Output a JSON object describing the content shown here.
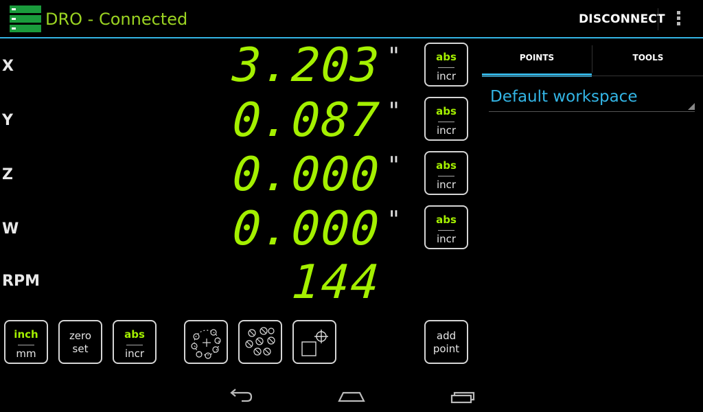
{
  "app": {
    "title": "DRO - Connected",
    "icon": "dro-app-icon",
    "accent": "#33b5e5",
    "digit_color": "#a4f000"
  },
  "actionbar": {
    "disconnect_label": "DISCONNECT",
    "overflow_icon": "overflow-menu-icon"
  },
  "axes": [
    {
      "label": "X",
      "value": "3.203",
      "unit": "\"",
      "toggle_top": "abs",
      "toggle_bottom": "incr"
    },
    {
      "label": "Y",
      "value": "0.087",
      "unit": "\"",
      "toggle_top": "abs",
      "toggle_bottom": "incr"
    },
    {
      "label": "Z",
      "value": "0.000",
      "unit": "\"",
      "toggle_top": "abs",
      "toggle_bottom": "incr"
    },
    {
      "label": "W",
      "value": "0.000",
      "unit": "\"",
      "toggle_top": "abs",
      "toggle_bottom": "incr"
    }
  ],
  "rpm": {
    "label": "RPM",
    "value": "144"
  },
  "toolbar": {
    "units_top": "inch",
    "units_bottom": "mm",
    "zero_line1": "zero",
    "zero_line2": "set",
    "mode_top": "abs",
    "mode_bottom": "incr",
    "bolt_circle_icon": "bolt-circle-icon",
    "hole_pattern_icon": "hole-pattern-icon",
    "tool_offset_icon": "tool-offset-icon",
    "add_line1": "add",
    "add_line2": "point"
  },
  "side_panel": {
    "tabs": [
      {
        "label": "POINTS",
        "active": true
      },
      {
        "label": "TOOLS",
        "active": false
      }
    ],
    "workspace": "Default workspace"
  },
  "navbar": {
    "back_icon": "back-icon",
    "home_icon": "home-icon",
    "recents_icon": "recents-icon"
  }
}
